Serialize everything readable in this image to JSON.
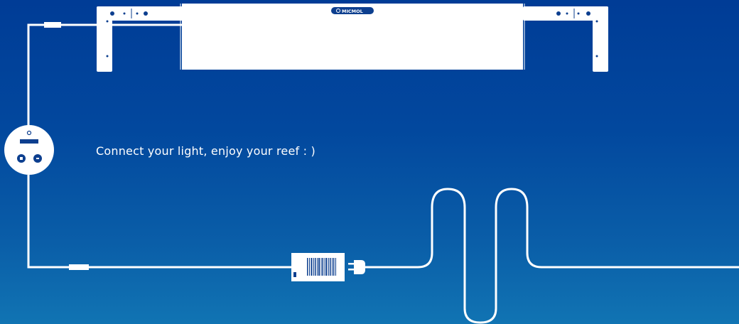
{
  "brand": {
    "logo_text": "MICMOL"
  },
  "tagline": "Connect your light, enjoy your reef : )",
  "colors": {
    "background_top": "#003c96",
    "background_bottom": "#1174b3",
    "line": "#ffffff",
    "accent": "#1a4fa3"
  },
  "icons": {
    "controller": "controller-icon",
    "power_adapter": "power-adapter-icon",
    "plug": "plug-icon"
  }
}
